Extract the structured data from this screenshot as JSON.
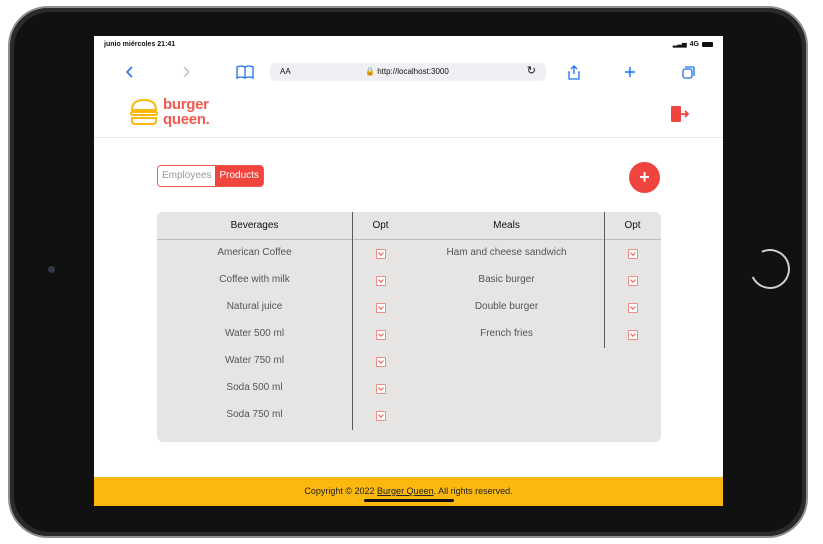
{
  "status": {
    "time": "junio miércoles 21:41",
    "network": "4G"
  },
  "browser": {
    "text_size": "AA",
    "url": "http://localhost:3000"
  },
  "app": {
    "brand_line1": "burger",
    "brand_line2": "queen.",
    "tabs": [
      "Employees",
      "Products"
    ],
    "add_button": "+"
  },
  "table": {
    "beverages_header": "Beverages",
    "meals_header": "Meals",
    "opt_header": "Opt",
    "beverages": [
      "American Coffee",
      "Coffee with milk",
      "Natural juice",
      "Water 500 ml",
      "Water 750 ml",
      "Soda 500 ml",
      "Soda 750 ml"
    ],
    "meals": [
      "Ham and cheese sandwich",
      "Basic burger",
      "Double burger",
      "French fries"
    ]
  },
  "footer": {
    "prefix": "Copyright © 2022 ",
    "brand": "Burger Queen",
    "suffix": ". All rights reserved."
  },
  "colors": {
    "accent": "#f0443e",
    "footer": "#fbb80f",
    "card": "#e7e5e3"
  },
  "icons": [
    "back-icon",
    "forward-icon",
    "bookmarks-icon",
    "lock-icon",
    "reload-icon",
    "share-icon",
    "new-tab-icon",
    "tabs-icon",
    "logout-icon",
    "dropdown-icon"
  ]
}
